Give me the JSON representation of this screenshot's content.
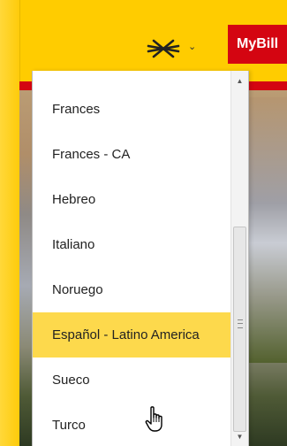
{
  "header": {
    "language_icon": "flag-globe-icon",
    "dropdown_indicator": "chevron-down-icon",
    "mybill_label": "MyBill"
  },
  "language_menu": {
    "options": [
      "Frances",
      "Frances - CA",
      "Hebreo",
      "Italiano",
      "Noruego",
      "Español - Latino America",
      "Sueco",
      "Turco"
    ],
    "highlighted_option": "Español - Latino America"
  },
  "colors": {
    "brand_yellow": "#ffcc00",
    "brand_red": "#d40511",
    "highlight": "#fdd94c"
  },
  "cursor": "hand-pointer-icon"
}
